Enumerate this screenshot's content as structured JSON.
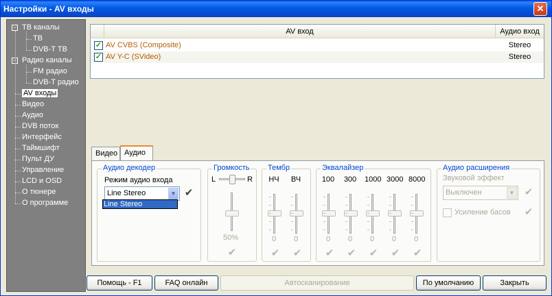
{
  "window": {
    "title": "Настройки - AV входы",
    "close_glyph": "✕"
  },
  "tree": {
    "items": [
      {
        "label": "ТВ каналы",
        "expander": "−"
      },
      {
        "label": "ТВ"
      },
      {
        "label": "DVB-T ТВ"
      },
      {
        "label": "Радио каналы",
        "expander": "−"
      },
      {
        "label": "FM радио"
      },
      {
        "label": "DVB-T радио"
      },
      {
        "label": "AV входы",
        "selected": true
      },
      {
        "label": "Видео"
      },
      {
        "label": "Аудио"
      },
      {
        "label": "DVB поток"
      },
      {
        "label": "Интерфейс"
      },
      {
        "label": "Таймшифт"
      },
      {
        "label": "Пульт ДУ"
      },
      {
        "label": "Управление"
      },
      {
        "label": "LCD и OSD"
      },
      {
        "label": "О тюнере"
      },
      {
        "label": "О программе"
      }
    ]
  },
  "list": {
    "columns": [
      "AV вход",
      "Аудио вход"
    ],
    "rows": [
      {
        "name": "AV CVBS (Composite)",
        "audio": "Stereo",
        "checked": true
      },
      {
        "name": "AV Y-C (SVideo)",
        "audio": "Stereo",
        "checked": true
      }
    ],
    "check_glyph": "✓"
  },
  "tabs": {
    "video": "Видео",
    "audio": "Аудио",
    "active": "audio"
  },
  "audio": {
    "decoder": {
      "title": "Аудио декодер",
      "mode_label": "Режим аудио входа",
      "mode_value": "Line Stereo",
      "dropdown_option": "Line Stereo"
    },
    "volume": {
      "title": "Громкость",
      "left": "L",
      "right": "R",
      "value_text": "50%",
      "level_percent": 50,
      "balance_percent": 50
    },
    "tone": {
      "title": "Тембр",
      "bands": [
        {
          "label": "НЧ",
          "value": "0"
        },
        {
          "label": "ВЧ",
          "value": "0"
        }
      ]
    },
    "equalizer": {
      "title": "Эквалайзер",
      "bands": [
        {
          "label": "100",
          "value": "0"
        },
        {
          "label": "300",
          "value": "0"
        },
        {
          "label": "1000",
          "value": "0"
        },
        {
          "label": "3000",
          "value": "0"
        },
        {
          "label": "8000",
          "value": "0"
        }
      ]
    },
    "extensions": {
      "title": "Аудио расширения",
      "effect_label": "Звуковой эффект",
      "effect_value": "Выключен",
      "bass_label": "Усиление басов",
      "bass_checked": false
    }
  },
  "apply_glyph": "✔",
  "combo_arrow": "▼",
  "buttons": {
    "help": "Помощь - F1",
    "faq": "FAQ онлайн",
    "autoscan": "Автосканирование",
    "defaults": "По умолчанию",
    "close": "Закрыть"
  },
  "colors": {
    "title_bar": "#0058e6",
    "tree_bg": "#808080",
    "input_name": "#b15f00",
    "group_title": "#0046d5",
    "selection": "#316ac5"
  }
}
